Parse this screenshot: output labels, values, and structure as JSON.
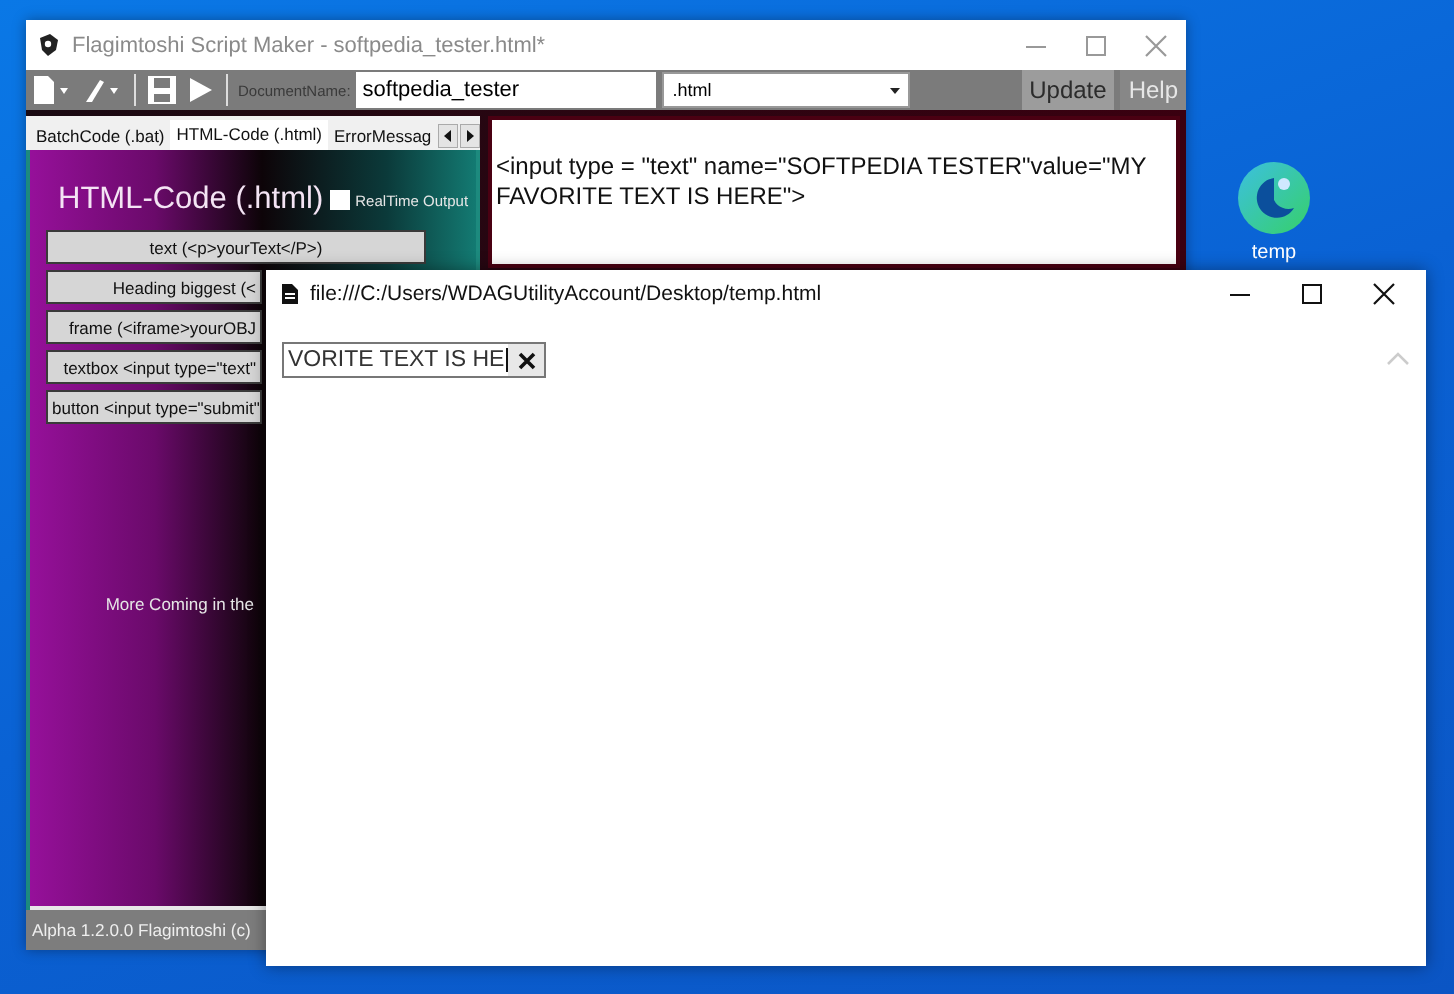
{
  "desktop": {
    "icons": [
      {
        "label": "temp"
      }
    ]
  },
  "editor_window": {
    "title": "Flagimtoshi Script Maker - softpedia_tester.html*",
    "toolbar": {
      "document_name_label": "DocumentName:",
      "document_name": "softpedia_tester",
      "extension": ".html",
      "buttons": [
        "Update",
        "Help"
      ]
    },
    "tabs": [
      {
        "label": "BatchCode (.bat)",
        "selected": false
      },
      {
        "label": "HTML-Code (.html)",
        "selected": true
      },
      {
        "label": "ErrorMessag",
        "selected": false
      }
    ],
    "panel": {
      "heading": "HTML-Code (.html)",
      "realtime_output": {
        "label": "RealTime Output",
        "checked": false
      },
      "snippet_buttons": [
        "text (<p>yourText</P>)",
        "Heading biggest (<",
        "frame (<iframe>yourOBJ",
        "textbox <input type=\"text\"",
        "button <input type=\"submit\""
      ],
      "note": "More Coming in the"
    },
    "code_text": "<input type = \"text\" name=\"SOFTPEDIA TESTER\"value=\"MY FAVORITE TEXT IS HERE\">",
    "status_bar": "Alpha 1.2.0.0 Flagimtoshi (c)"
  },
  "browser_window": {
    "title": "file:///C:/Users/WDAGUtilityAccount/Desktop/temp.html",
    "text_field": {
      "value": "VORITE TEXT IS HE"
    }
  }
}
